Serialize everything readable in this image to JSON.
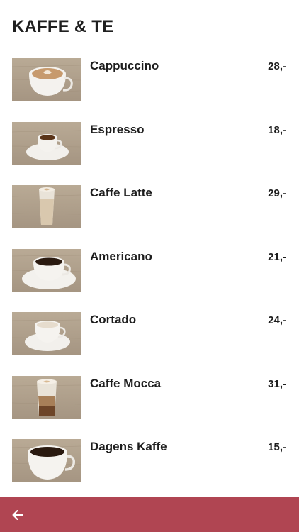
{
  "header": {
    "title": "KAFFE & TE"
  },
  "menu": {
    "items": [
      {
        "name": "Cappuccino",
        "price": "28,-",
        "icon": "cappuccino-cup-photo"
      },
      {
        "name": "Espresso",
        "price": "18,-",
        "icon": "espresso-cup-photo"
      },
      {
        "name": "Caffe Latte",
        "price": "29,-",
        "icon": "latte-glass-photo"
      },
      {
        "name": "Americano",
        "price": "21,-",
        "icon": "americano-cup-photo"
      },
      {
        "name": "Cortado",
        "price": "24,-",
        "icon": "cortado-cup-photo"
      },
      {
        "name": "Caffe Mocca",
        "price": "31,-",
        "icon": "mocca-glass-photo"
      },
      {
        "name": "Dagens Kaffe",
        "price": "15,-",
        "icon": "daily-coffee-cup-photo"
      }
    ]
  },
  "bottombar": {
    "back_icon": "arrow-left-icon",
    "color": "#b04552"
  }
}
